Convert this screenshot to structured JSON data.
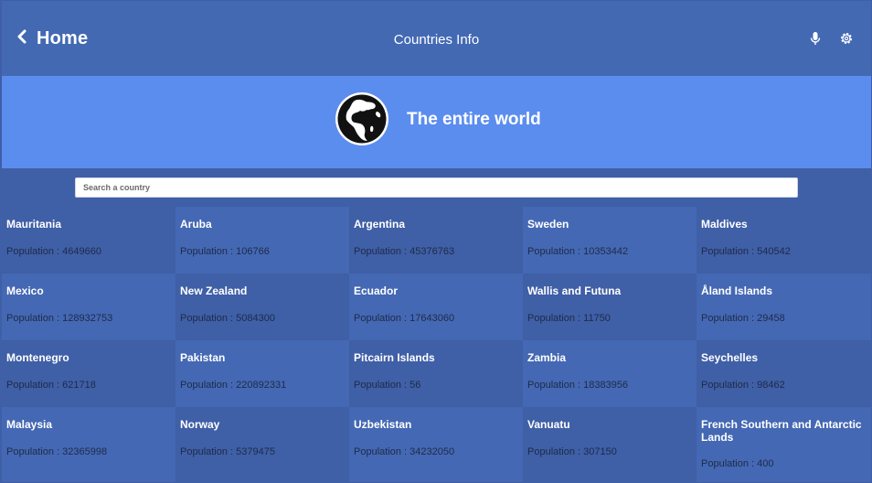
{
  "header": {
    "back_label": "Home",
    "title": "Countries Info",
    "icons": [
      "chevron-left-icon",
      "microphone-icon",
      "gear-icon"
    ]
  },
  "banner": {
    "title": "The entire world",
    "icon": "globe-icon"
  },
  "search": {
    "placeholder": "Search a country",
    "value": ""
  },
  "countries": [
    {
      "name": "Mauritania",
      "population": "Population : 4649660"
    },
    {
      "name": "Aruba",
      "population": "Population : 106766"
    },
    {
      "name": "Argentina",
      "population": "Population : 45376763"
    },
    {
      "name": "Sweden",
      "population": "Population : 10353442"
    },
    {
      "name": "Maldives",
      "population": "Population : 540542"
    },
    {
      "name": "Mexico",
      "population": "Population : 128932753"
    },
    {
      "name": "New Zealand",
      "population": "Population : 5084300"
    },
    {
      "name": "Ecuador",
      "population": "Population : 17643060"
    },
    {
      "name": "Wallis and Futuna",
      "population": "Population : 11750"
    },
    {
      "name": "Åland Islands",
      "population": "Population : 29458"
    },
    {
      "name": "Montenegro",
      "population": "Population : 621718"
    },
    {
      "name": "Pakistan",
      "population": "Population : 220892331"
    },
    {
      "name": "Pitcairn Islands",
      "population": "Population : 56"
    },
    {
      "name": "Zambia",
      "population": "Population : 18383956"
    },
    {
      "name": "Seychelles",
      "population": "Population : 98462"
    },
    {
      "name": "Malaysia",
      "population": "Population : 32365998"
    },
    {
      "name": "Norway",
      "population": "Population : 5379475"
    },
    {
      "name": "Uzbekistan",
      "population": "Population : 34232050"
    },
    {
      "name": "Vanuatu",
      "population": "Population : 307150"
    },
    {
      "name": "French Southern and Antarctic Lands",
      "population": "Population : 400"
    }
  ],
  "colors": {
    "header_bg": "#4369b3",
    "banner_bg": "#5b8def",
    "card_dark": "#3f5fa6",
    "card_light": "#4468b3"
  }
}
